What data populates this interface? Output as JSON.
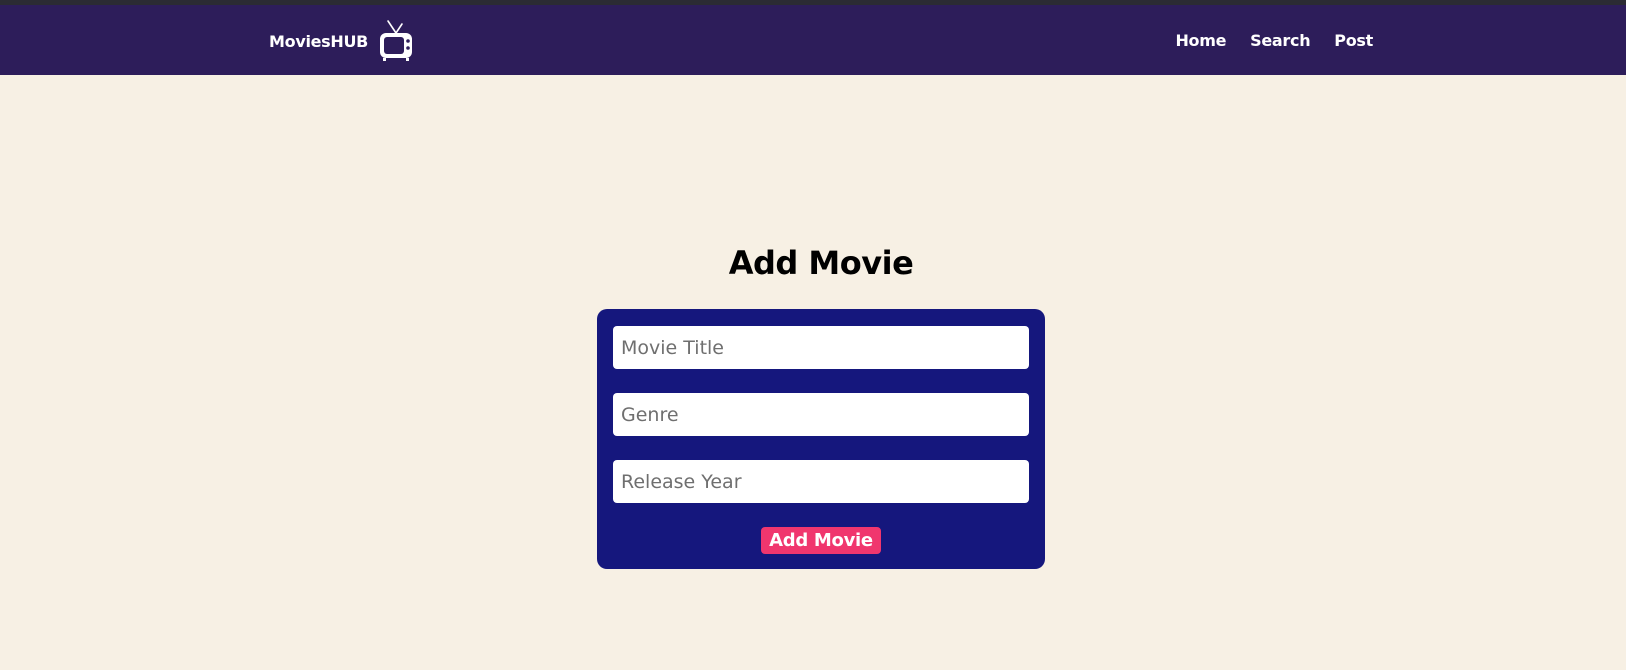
{
  "navbar": {
    "brand": "MoviesHUB",
    "brand_icon": "tv-icon",
    "links": [
      "Home",
      "Search",
      "Post"
    ]
  },
  "page": {
    "title": "Add Movie"
  },
  "form": {
    "title_placeholder": "Movie Title",
    "genre_placeholder": "Genre",
    "year_placeholder": "Release Year",
    "submit_label": "Add Movie"
  },
  "colors": {
    "navbar_bg": "#2d1d5a",
    "page_bg": "#f7f0e4",
    "form_bg": "#15177d",
    "button_bg": "#f0366e"
  }
}
